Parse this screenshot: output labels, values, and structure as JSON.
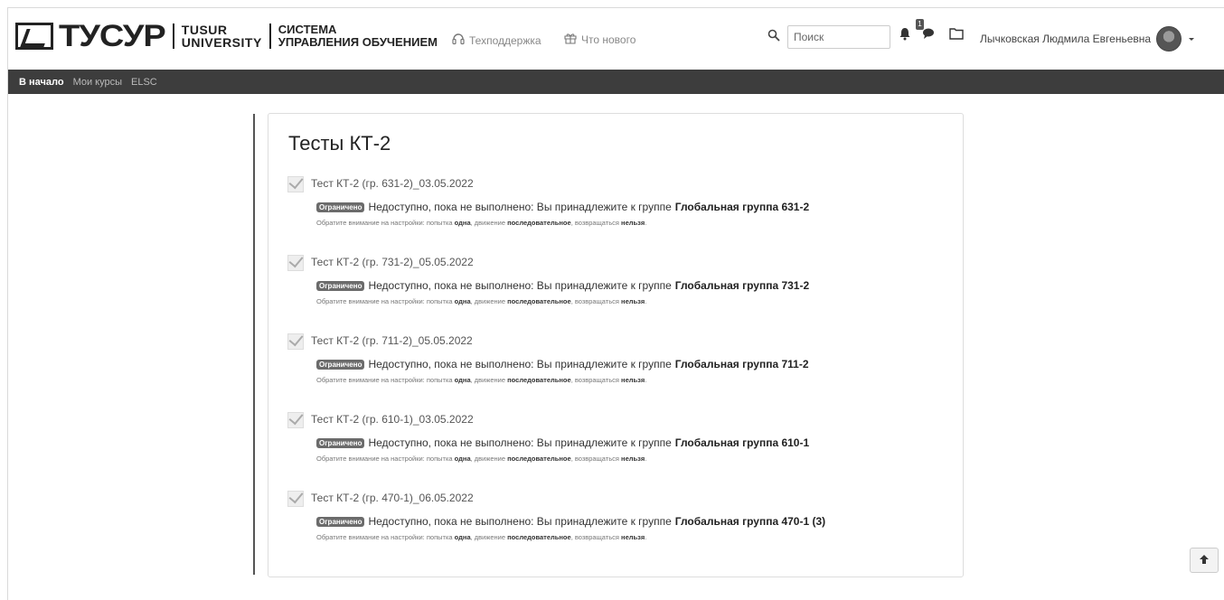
{
  "header": {
    "logo_word": "ТУСУР",
    "logo_uni_line1": "TUSUR",
    "logo_uni_line2": "UNIVERSITY",
    "logo_sys_line1": "СИСТЕМА",
    "logo_sys_line2": "УПРАВЛЕНИЯ ОБУЧЕНИЕМ",
    "support_label": "Техподдержка",
    "whatsnew_label": "Что нового",
    "search_placeholder": "Поиск",
    "notification_count": "1",
    "user_name": "Лычковская Людмила Евгеньевна"
  },
  "breadcrumb": [
    "В начало",
    "Мои курсы",
    "ELSC"
  ],
  "section": {
    "title": "Тесты КТ-2",
    "restricted_tag": "Ограничено",
    "restrict_prefix": "Недоступно, пока не выполнено: Вы принадлежите к группе",
    "note_prefix": "Обратите внимание на настройки: попытка",
    "note_attempt": "одна",
    "note_mid": ", движение",
    "note_move": "последовательное",
    "note_mid2": ", возвращаться",
    "note_return": "нельзя",
    "note_end": ".",
    "activities": [
      {
        "name": "Тест КТ-2 (гр. 631-2)_03.05.2022",
        "group": "Глобальная группа 631-2"
      },
      {
        "name": "Тест КТ-2 (гр. 731-2)_05.05.2022",
        "group": "Глобальная группа 731-2"
      },
      {
        "name": "Тест КТ-2 (гр. 711-2)_05.05.2022",
        "group": "Глобальная группа 711-2"
      },
      {
        "name": "Тест КТ-2 (гр. 610-1)_03.05.2022",
        "group": "Глобальная группа 610-1"
      },
      {
        "name": "Тест КТ-2 (гр. 470-1)_06.05.2022",
        "group": "Глобальная группа 470-1 (3)"
      }
    ]
  }
}
